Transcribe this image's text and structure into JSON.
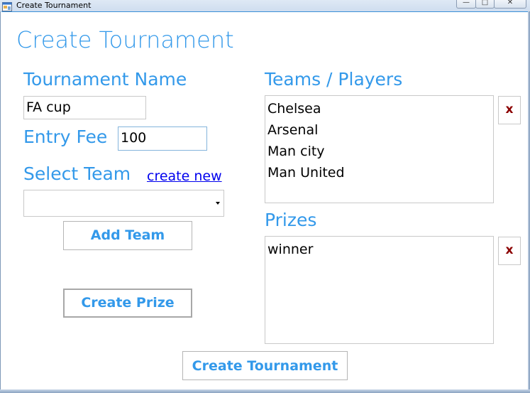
{
  "window": {
    "title": "Create Tournament",
    "controls": {
      "minimize": "—",
      "maximize": "□",
      "close": "✕"
    }
  },
  "form": {
    "page_title": "Create Tournament",
    "tournament_name_label": "Tournament Name",
    "tournament_name_value": "FA cup",
    "entry_fee_label": "Entry Fee",
    "entry_fee_value": "100",
    "select_team_label": "Select Team",
    "create_new_link": "create new",
    "select_team_value": "",
    "add_team_button": "Add Team",
    "create_prize_button": "Create Prize",
    "create_tournament_button": "Create Tournament"
  },
  "teams": {
    "label": "Teams / Players",
    "items": [
      "Chelsea",
      "Arsenal",
      "Man city",
      "Man United"
    ],
    "delete_label": "x"
  },
  "prizes": {
    "label": "Prizes",
    "items": [
      "winner"
    ],
    "delete_label": "x"
  },
  "colors": {
    "label_blue": "#3399ea",
    "link_blue": "#0000ee",
    "delete_red": "#8b0000"
  }
}
